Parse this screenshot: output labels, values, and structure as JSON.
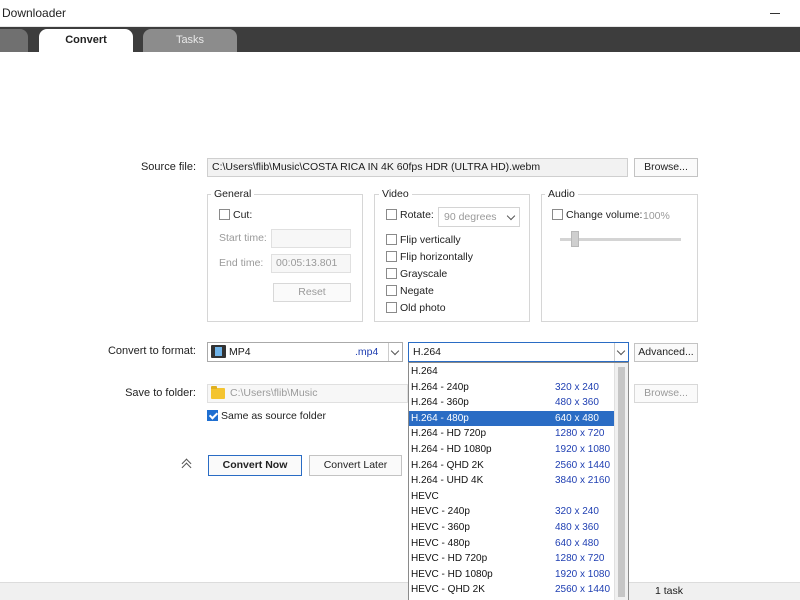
{
  "window": {
    "title": "Downloader"
  },
  "tabs": [
    {
      "label": ""
    },
    {
      "label": "Convert"
    },
    {
      "label": "Tasks"
    }
  ],
  "source": {
    "label": "Source file:",
    "value": "C:\\Users\\flib\\Music\\COSTA RICA IN 4K 60fps HDR (ULTRA HD).webm",
    "browse_label": "Browse..."
  },
  "general": {
    "title": "General",
    "cut_label": "Cut:",
    "start_label": "Start time:",
    "start_value": "",
    "end_label": "End time:",
    "end_value": "00:05:13.801",
    "reset_label": "Reset"
  },
  "video": {
    "title": "Video",
    "rotate_label": "Rotate:",
    "rotate_value": "90 degrees",
    "options": [
      {
        "label": "Flip vertically"
      },
      {
        "label": "Flip horizontally"
      },
      {
        "label": "Grayscale"
      },
      {
        "label": "Negate"
      },
      {
        "label": "Old photo"
      }
    ]
  },
  "audio": {
    "title": "Audio",
    "change_volume_label": "Change volume:",
    "volume_value": "100%",
    "volume_level": 0.1
  },
  "format": {
    "label": "Convert to format:",
    "container": "MP4",
    "extension": ".mp4",
    "codec": "H.264",
    "advanced_label": "Advanced...",
    "icon": "mp4-file-icon"
  },
  "dropdown": {
    "items": [
      {
        "name": "H.264",
        "res": ""
      },
      {
        "name": "H.264 - 240p",
        "res": "320 x 240"
      },
      {
        "name": "H.264 - 360p",
        "res": "480 x 360"
      },
      {
        "name": "H.264 - 480p",
        "res": "640 x 480",
        "selected": true
      },
      {
        "name": "H.264 - HD 720p",
        "res": "1280 x 720"
      },
      {
        "name": "H.264 - HD 1080p",
        "res": "1920 x 1080"
      },
      {
        "name": "H.264 - QHD 2K",
        "res": "2560 x 1440"
      },
      {
        "name": "H.264 - UHD 4K",
        "res": "3840 x 2160"
      },
      {
        "name": "HEVC",
        "res": ""
      },
      {
        "name": "HEVC - 240p",
        "res": "320 x 240"
      },
      {
        "name": "HEVC - 360p",
        "res": "480 x 360"
      },
      {
        "name": "HEVC - 480p",
        "res": "640 x 480"
      },
      {
        "name": "HEVC - HD 720p",
        "res": "1280 x 720"
      },
      {
        "name": "HEVC - HD 1080p",
        "res": "1920 x 1080"
      },
      {
        "name": "HEVC - QHD 2K",
        "res": "2560 x 1440"
      }
    ]
  },
  "save": {
    "label": "Save to folder:",
    "value": "C:\\Users\\flib\\Music",
    "browse_label": "Browse...",
    "same_as_source_label": "Same as source folder"
  },
  "actions": {
    "convert_now": "Convert Now",
    "convert_later": "Convert Later"
  },
  "status": {
    "tasks": "1 task"
  },
  "colors": {
    "accent": "#2a6cc4",
    "tabbar": "#3d3d3d",
    "resolution_text": "#1f3fb2"
  }
}
